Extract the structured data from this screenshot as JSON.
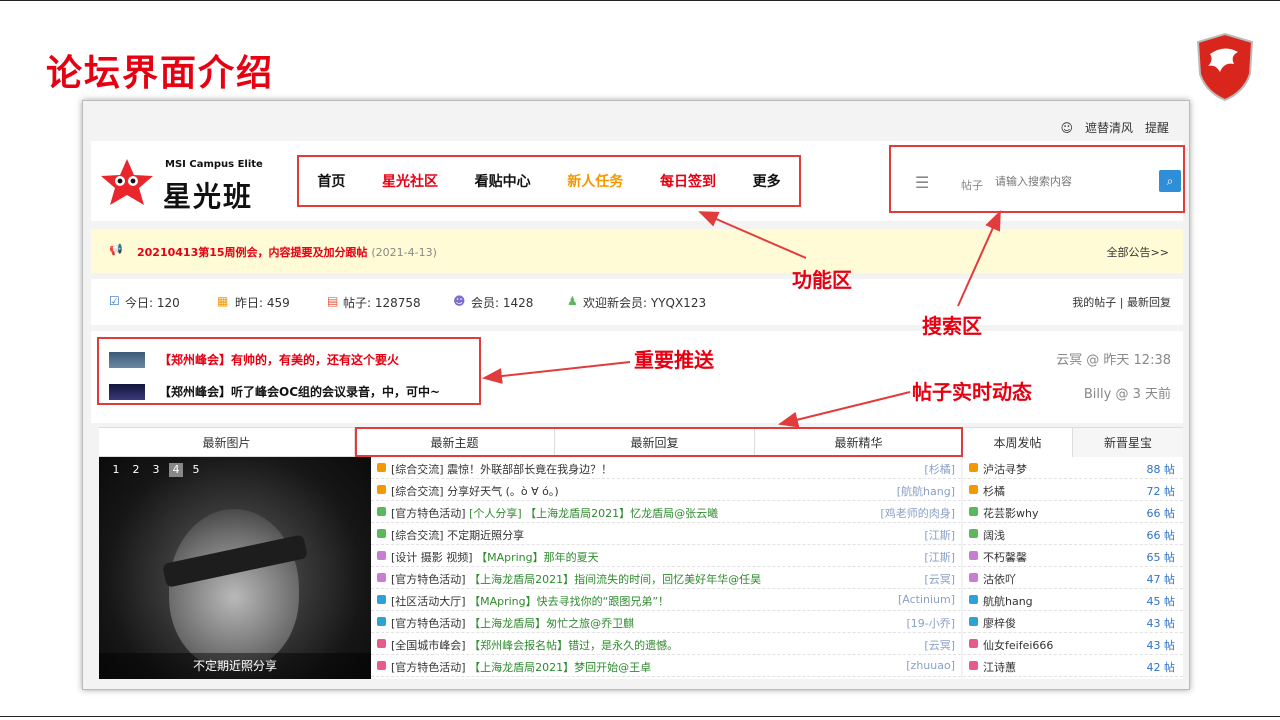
{
  "slide": {
    "title": "论坛界面介绍"
  },
  "topbar": {
    "username": "遮替清风",
    "remind": "提醒"
  },
  "brand": {
    "sub": "MSI Campus Elite",
    "name": "星光班"
  },
  "nav": [
    {
      "label": "首页",
      "color": "#111111"
    },
    {
      "label": "星光社区",
      "color": "#e60012"
    },
    {
      "label": "看贴中心",
      "color": "#111111"
    },
    {
      "label": "新人任务",
      "color": "#f39800"
    },
    {
      "label": "每日签到",
      "color": "#e60012"
    },
    {
      "label": "更多",
      "color": "#111111"
    }
  ],
  "search": {
    "label": "帖子",
    "placeholder": "请输入搜索内容"
  },
  "notice": {
    "text": "20210413第15周例会，内容提要及加分跟帖",
    "date": "(2021-4-13)",
    "all": "全部公告>>"
  },
  "stats": {
    "today": "今日: 120",
    "yesterday": "昨日: 459",
    "posts": "帖子: 128758",
    "members": "会员: 1428",
    "welcome": "欢迎新会员: YYQX123",
    "right": "我的帖子 | 最新回复"
  },
  "push": {
    "items": [
      "【郑州峰会】有帅的，有美的，还有这个要火",
      "【郑州峰会】听了峰会OC组的会议录音，中，可中~"
    ],
    "meta": [
      "云冥 @ 昨天 12:38",
      "Billy @ 3 天前"
    ]
  },
  "tabs": [
    "最新图片",
    "最新主题",
    "最新回复",
    "最新精华",
    "本周发帖",
    "新晋星宝"
  ],
  "photo": {
    "nums": [
      "1",
      "2",
      "3",
      "4",
      "5"
    ],
    "caption": "不定期近照分享"
  },
  "threads": [
    {
      "cat": "[综合交流]",
      "title": "震惊！外联部部长竟在我身边？！",
      "author": "[杉橘]",
      "color": "#f39800",
      "green": false
    },
    {
      "cat": "[综合交流]",
      "title": "分享好天气 (。ò ∀ ó。)",
      "author": "[航航hang]",
      "color": "#f39800",
      "green": false
    },
    {
      "cat": "[官方特色活动]",
      "title": "[个人分享] 【上海龙盾局2021】忆龙盾局@张云曦",
      "author": "[鸡老师的肉身]",
      "color": "#5cb85c",
      "green": true
    },
    {
      "cat": "[综合交流]",
      "title": "不定期近照分享",
      "author": "[江斯]",
      "color": "#5cb85c",
      "green": false
    },
    {
      "cat": "[设计 摄影 视频]",
      "title": "【MApring】那年的夏天",
      "author": "[江斯]",
      "color": "#c77dd1",
      "green": true
    },
    {
      "cat": "[官方特色活动]",
      "title": "【上海龙盾局2021】指间流失的时间，回忆美好年华@任昊",
      "author": "[云冥]",
      "color": "#c77dd1",
      "green": true
    },
    {
      "cat": "[社区活动大厅]",
      "title": "【MApring】快去寻找你的“跟图兄弟”！",
      "author": "[Actinium]",
      "color": "#2fa0d8",
      "green": true
    },
    {
      "cat": "[官方特色活动]",
      "title": "【上海龙盾局】匆忙之旅@乔卫麒",
      "author": "[19-小乔]",
      "color": "#2fa0d8",
      "green": true
    },
    {
      "cat": "[全国城市峰会]",
      "title": "【郑州峰会报名帖】错过，是永久的遗憾。",
      "author": "[云冥]",
      "color": "#e85a8c",
      "green": true
    },
    {
      "cat": "[官方特色活动]",
      "title": "【上海龙盾局2021】梦回开始@王卓",
      "author": "[zhuuao]",
      "color": "#e85a8c",
      "green": true
    }
  ],
  "ranking": [
    {
      "name": "泸沽寻梦",
      "count": "88 帖",
      "color": "#f39800"
    },
    {
      "name": "杉橘",
      "count": "72 帖",
      "color": "#f39800"
    },
    {
      "name": "花芸影why",
      "count": "66 帖",
      "color": "#5cb85c"
    },
    {
      "name": "阔浅",
      "count": "66 帖",
      "color": "#5cb85c"
    },
    {
      "name": "不朽馨馨",
      "count": "65 帖",
      "color": "#c77dd1"
    },
    {
      "name": "沽依吖",
      "count": "47 帖",
      "color": "#c77dd1"
    },
    {
      "name": "航航hang",
      "count": "45 帖",
      "color": "#2fa0d8"
    },
    {
      "name": "廖梓俊",
      "count": "43 帖",
      "color": "#2fa0d8"
    },
    {
      "name": "仙女feifei666",
      "count": "43 帖",
      "color": "#e85a8c"
    },
    {
      "name": "江诗蕙",
      "count": "42 帖",
      "color": "#e85a8c"
    }
  ],
  "annotations": {
    "function": "功能区",
    "search": "搜索区",
    "push": "重要推送",
    "dynamic": "帖子实时动态"
  }
}
